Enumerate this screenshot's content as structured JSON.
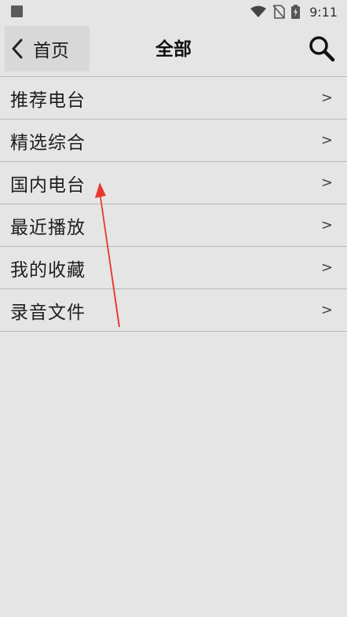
{
  "status_bar": {
    "time": "9:11",
    "icons": [
      "notification-square-icon",
      "wifi-icon",
      "no-sim-icon",
      "battery-charging-icon"
    ]
  },
  "header": {
    "back_label": "首页",
    "title": "全部",
    "search_icon": "search-icon"
  },
  "menu": {
    "items": [
      {
        "label": "推荐电台",
        "arrow": ">"
      },
      {
        "label": "精选综合",
        "arrow": ">"
      },
      {
        "label": "国内电台",
        "arrow": ">"
      },
      {
        "label": "最近播放",
        "arrow": ">"
      },
      {
        "label": "我的收藏",
        "arrow": ">"
      },
      {
        "label": "录音文件",
        "arrow": ">"
      }
    ]
  },
  "annotation": {
    "color": "#e8382c"
  }
}
